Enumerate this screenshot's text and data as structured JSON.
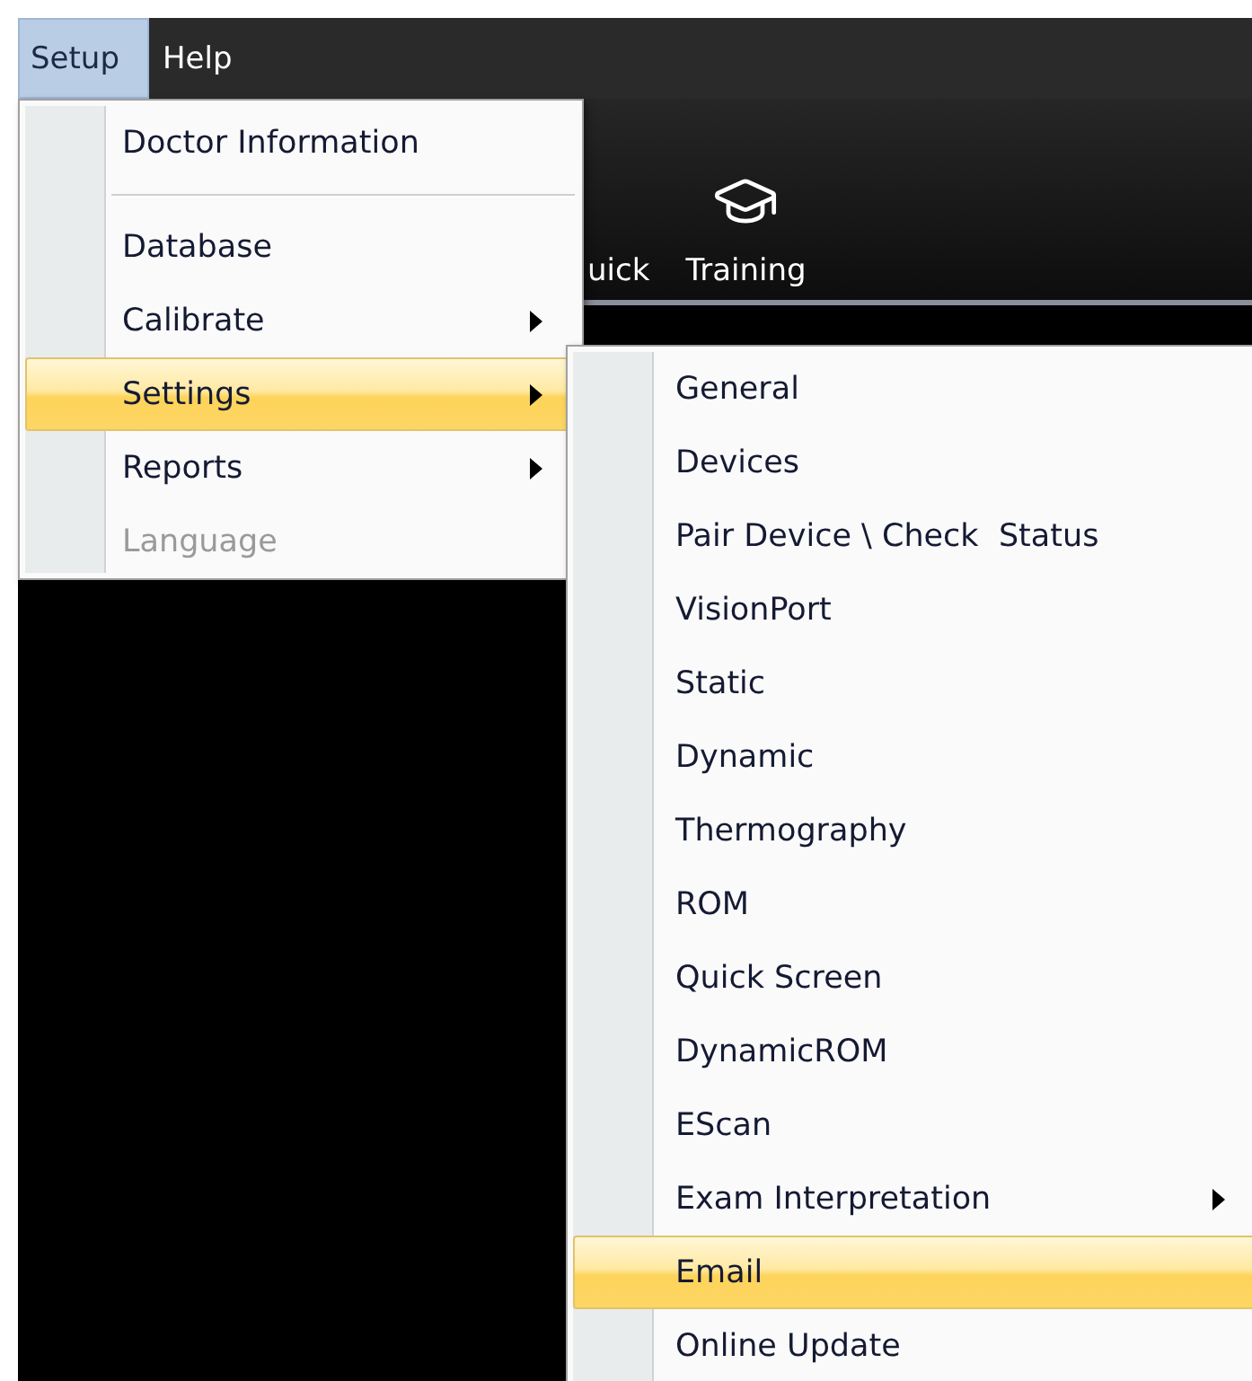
{
  "menubar": [
    {
      "label": "Setup",
      "selected": true
    },
    {
      "label": "Help",
      "selected": false
    }
  ],
  "toolbar": [
    {
      "label": "uick"
    },
    {
      "label": "Training"
    }
  ],
  "setup_menu": {
    "items": [
      {
        "kind": "item",
        "label": "Doctor Information",
        "selected": false,
        "disabled": false,
        "has_submenu": false
      },
      {
        "kind": "separator"
      },
      {
        "kind": "item",
        "label": "Database",
        "selected": false,
        "disabled": false,
        "has_submenu": false
      },
      {
        "kind": "item",
        "label": "Calibrate",
        "selected": false,
        "disabled": false,
        "has_submenu": true
      },
      {
        "kind": "item",
        "label": "Settings",
        "selected": true,
        "disabled": false,
        "has_submenu": true
      },
      {
        "kind": "item",
        "label": "Reports",
        "selected": false,
        "disabled": false,
        "has_submenu": true
      },
      {
        "kind": "item",
        "label": "Language",
        "selected": false,
        "disabled": true,
        "has_submenu": false
      }
    ]
  },
  "settings_submenu": {
    "items": [
      {
        "kind": "item",
        "label": "General",
        "selected": false,
        "disabled": false,
        "has_submenu": false
      },
      {
        "kind": "item",
        "label": "Devices",
        "selected": false,
        "disabled": false,
        "has_submenu": false
      },
      {
        "kind": "item",
        "label": "Pair Device \\ Check  Status",
        "selected": false,
        "disabled": false,
        "has_submenu": false
      },
      {
        "kind": "item",
        "label": "VisionPort",
        "selected": false,
        "disabled": false,
        "has_submenu": false
      },
      {
        "kind": "item",
        "label": "Static",
        "selected": false,
        "disabled": false,
        "has_submenu": false
      },
      {
        "kind": "item",
        "label": "Dynamic",
        "selected": false,
        "disabled": false,
        "has_submenu": false
      },
      {
        "kind": "item",
        "label": "Thermography",
        "selected": false,
        "disabled": false,
        "has_submenu": false
      },
      {
        "kind": "item",
        "label": "ROM",
        "selected": false,
        "disabled": false,
        "has_submenu": false
      },
      {
        "kind": "item",
        "label": "Quick Screen",
        "selected": false,
        "disabled": false,
        "has_submenu": false
      },
      {
        "kind": "item",
        "label": "DynamicROM",
        "selected": false,
        "disabled": false,
        "has_submenu": false
      },
      {
        "kind": "item",
        "label": "EScan",
        "selected": false,
        "disabled": false,
        "has_submenu": false
      },
      {
        "kind": "item",
        "label": "Exam Interpretation",
        "selected": false,
        "disabled": false,
        "has_submenu": true
      },
      {
        "kind": "item",
        "label": "Email",
        "selected": true,
        "disabled": false,
        "has_submenu": false
      },
      {
        "kind": "item",
        "label": "Online Update",
        "selected": false,
        "disabled": false,
        "has_submenu": false
      }
    ]
  }
}
